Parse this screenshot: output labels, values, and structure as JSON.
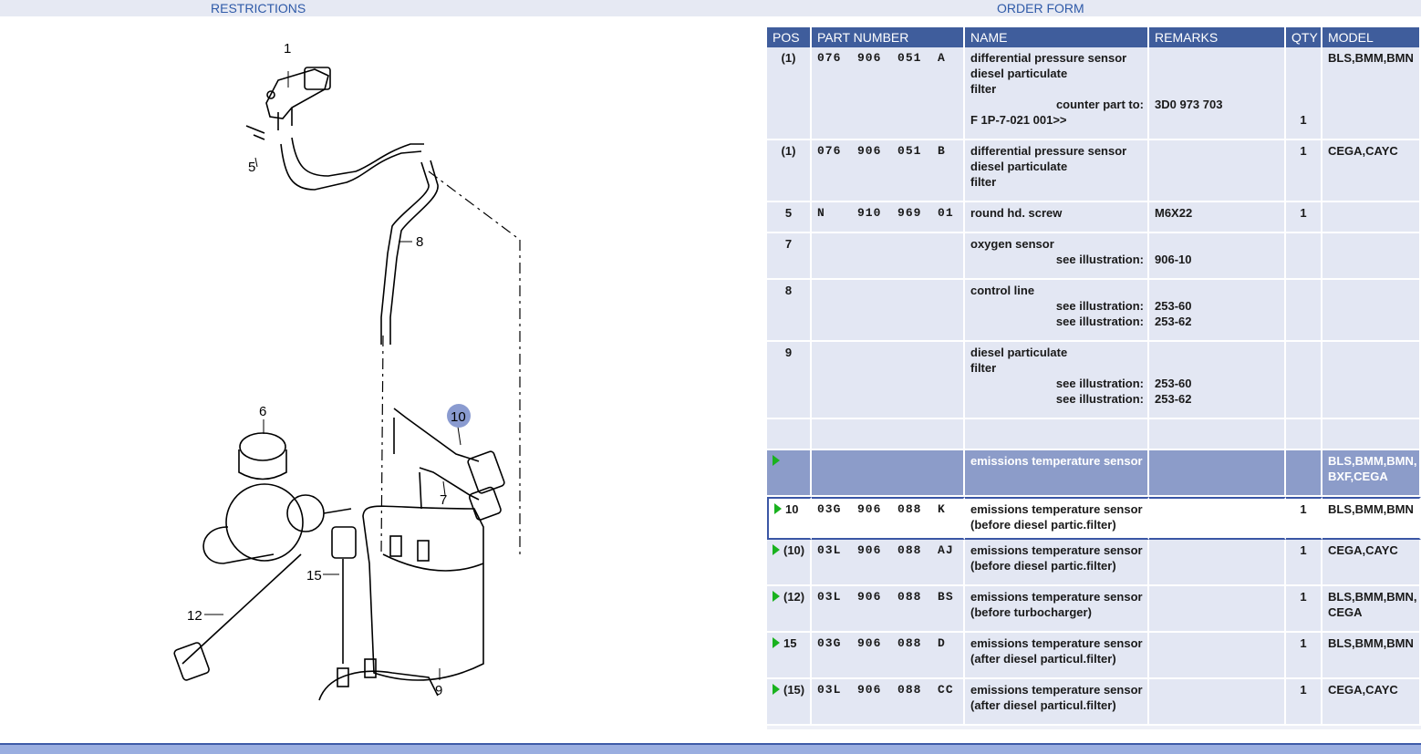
{
  "tabs": {
    "restrictions": "RESTRICTIONS",
    "order_form": "ORDER FORM"
  },
  "diagram": {
    "callouts": [
      "1",
      "5",
      "8",
      "6",
      "10",
      "7",
      "15",
      "12",
      "9"
    ],
    "highlight_color": "#8a9bd0"
  },
  "table": {
    "headers": {
      "pos": "POS",
      "part_number": "PART NUMBER",
      "name": "NAME",
      "remarks": "REMARKS",
      "qty": "QTY",
      "model": "MODEL"
    },
    "rows": [
      {
        "pos": "(1)",
        "part": "076  906  051  A",
        "name": "differential pressure sensor",
        "name2": "diesel particulate",
        "name3": "filter",
        "see_label": "counter part to:",
        "see_value": "3D0 973 703",
        "extra": "F 1P-7-021 001>>",
        "qty": "1",
        "model": "BLS,BMM,BMN"
      },
      {
        "pos": "(1)",
        "part": "076  906  051  B",
        "name": "differential pressure sensor",
        "name2": "diesel particulate",
        "name3": "filter",
        "qty": "1",
        "model": "CEGA,CAYC"
      },
      {
        "pos": "5",
        "part": "N    910  969  01",
        "name": "round hd. screw",
        "remarks": "M6X22",
        "qty": "1",
        "model": ""
      },
      {
        "pos": "7",
        "name": "oxygen sensor",
        "see_label": "see illustration:",
        "see_value": "906-10"
      },
      {
        "pos": "8",
        "name": "control line",
        "see_label": "see illustration:",
        "see_value": "253-60",
        "see_value2": "253-62"
      },
      {
        "pos": "9",
        "name": "diesel particulate",
        "name2": "filter",
        "see_label": "see illustration:",
        "see_value": "253-60",
        "see_value2": "253-62"
      },
      {
        "pos": "",
        "name": "emissions temperature sensor",
        "model": "BLS,BMM,BMN,",
        "model2": "BXF,CEGA"
      },
      {
        "pos": "10",
        "part": "03G  906  088  K",
        "name": "emissions temperature sensor",
        "name2": "(before diesel partic.filter)",
        "qty": "1",
        "model": "BLS,BMM,BMN"
      },
      {
        "pos": "(10)",
        "part": "03L  906  088  AJ",
        "name": "emissions temperature sensor",
        "name2": "(before diesel partic.filter)",
        "qty": "1",
        "model": "CEGA,CAYC"
      },
      {
        "pos": "(12)",
        "part": "03L  906  088  BS",
        "name": "emissions temperature sensor",
        "name2": "(before turbocharger)",
        "qty": "1",
        "model": "BLS,BMM,BMN,",
        "model2": "CEGA"
      },
      {
        "pos": "15",
        "part": "03G  906  088  D",
        "name": "emissions temperature sensor",
        "name2": "(after diesel particul.filter)",
        "qty": "1",
        "model": "BLS,BMM,BMN"
      },
      {
        "pos": "(15)",
        "part": "03L  906  088  CC",
        "name": "emissions temperature sensor",
        "name2": "(after diesel particul.filter)",
        "qty": "1",
        "model": "CEGA,CAYC"
      }
    ]
  }
}
